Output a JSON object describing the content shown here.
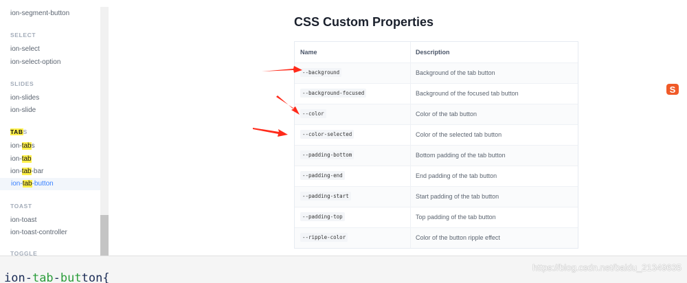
{
  "sidebar": {
    "items": [
      {
        "label": "ion-segment-button"
      },
      {
        "heading": "SELECT"
      },
      {
        "label": "ion-select"
      },
      {
        "label": "ion-select-option"
      },
      {
        "heading": "SLIDES"
      },
      {
        "label": "ion-slides"
      },
      {
        "label": "ion-slide"
      },
      {
        "heading_pre": "",
        "heading_hl": "TAB",
        "heading_post": "S"
      },
      {
        "pre": "ion-",
        "hl": "tab",
        "post": "s"
      },
      {
        "pre": "ion-",
        "hl": "tab",
        "post": ""
      },
      {
        "pre": "ion-",
        "hl": "tab",
        "post": "-bar"
      },
      {
        "pre": "ion-",
        "hl": "tab",
        "post": "-button",
        "active": true
      },
      {
        "heading": "TOAST"
      },
      {
        "label": "ion-toast"
      },
      {
        "label": "ion-toast-controller"
      },
      {
        "heading": "TOGGLE"
      }
    ]
  },
  "main": {
    "title": "CSS Custom Properties",
    "table": {
      "headers": {
        "name": "Name",
        "description": "Description"
      },
      "rows": [
        {
          "name": "--background",
          "description": "Background of the tab button"
        },
        {
          "name": "--background-focused",
          "description": "Background of the focused tab button"
        },
        {
          "name": "--color",
          "description": "Color of the tab button"
        },
        {
          "name": "--color-selected",
          "description": "Color of the selected tab button"
        },
        {
          "name": "--padding-bottom",
          "description": "Bottom padding of the tab button"
        },
        {
          "name": "--padding-end",
          "description": "End padding of the tab button"
        },
        {
          "name": "--padding-start",
          "description": "Start padding of the tab button"
        },
        {
          "name": "--padding-top",
          "description": "Top padding of the tab button"
        },
        {
          "name": "--ripple-color",
          "description": "Color of the button ripple effect"
        }
      ]
    }
  },
  "annotations": {
    "arrow_color": "#ff2a1a",
    "count": 3
  },
  "icon": {
    "name": "sogou-s-icon",
    "color": "#f05a28",
    "glyph": "S"
  },
  "footer": {
    "snippet_parts": [
      "ion-",
      "tab",
      "-",
      "but",
      "ton",
      "{"
    ],
    "watermark": "https://blog.csdn.net/baidu_21349635"
  }
}
